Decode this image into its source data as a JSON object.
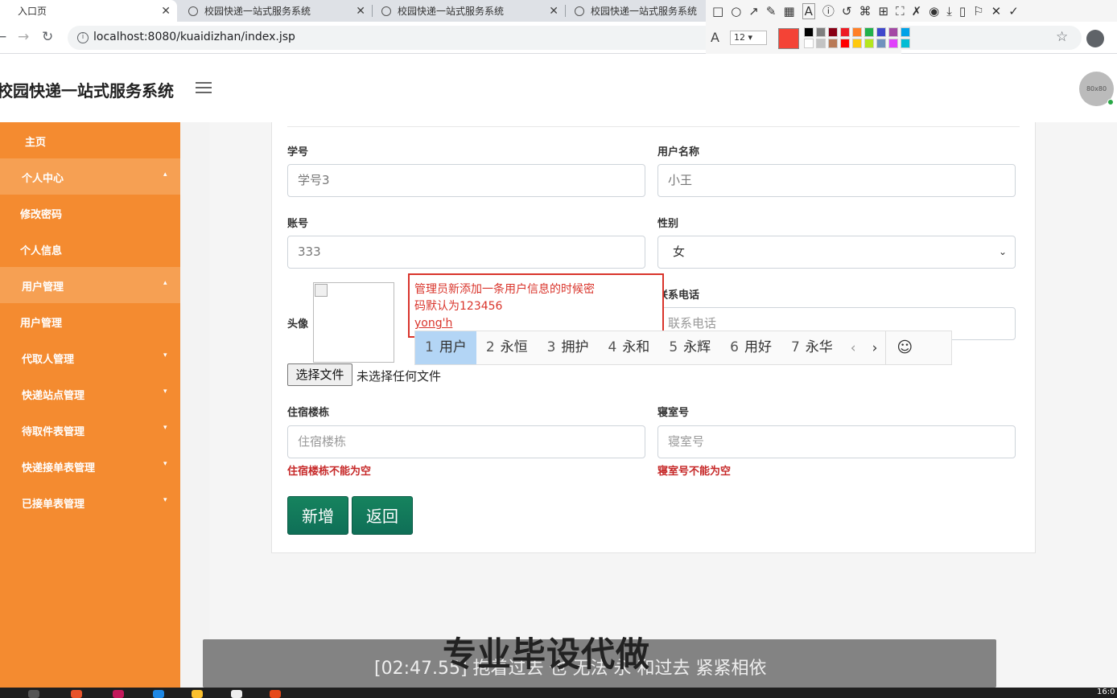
{
  "browser": {
    "tabs": [
      {
        "title": "入口页",
        "active": true
      },
      {
        "title": "校园快递一站式服务系统",
        "active": false
      },
      {
        "title": "校园快递一站式服务系统",
        "active": false
      },
      {
        "title": "校园快递一站式服务系统",
        "active": false
      }
    ],
    "url": "localhost:8080/kuaidizhan/index.jsp"
  },
  "annotation_toolbar": {
    "tools": [
      "rect-icon",
      "circle-icon",
      "arrow-icon",
      "pen-icon",
      "mosaic-icon",
      "text-icon",
      "number-icon",
      "undo-icon",
      "ocr-icon",
      "translate-icon",
      "pin-icon",
      "record-icon",
      "screen-record-icon",
      "download-icon",
      "save-icon",
      "bookmark-icon",
      "close-icon",
      "done-icon"
    ],
    "font_size": "12",
    "current_color": "#f44336",
    "swatches": [
      "#000000",
      "#7f7f7f",
      "#880015",
      "#ed1c24",
      "#ff7f27",
      "#22b14c",
      "#3f48cc",
      "#a349a4",
      "#00a2e8",
      "#ffffff",
      "#c3c3c3",
      "#b97a57",
      "#ff0000",
      "#ffc90e",
      "#b5e61d",
      "#7092be",
      "#e040fb",
      "#00bcd4"
    ]
  },
  "header": {
    "app_title": "校园快递一站式服务系统",
    "avatar_text": "80x80"
  },
  "sidebar": {
    "home": "主页",
    "personal_center": "个人中心",
    "change_password": "修改密码",
    "personal_info": "个人信息",
    "user_mgmt_group": "用户管理",
    "user_mgmt": "用户管理",
    "agent_mgmt": "代取人管理",
    "station_mgmt": "快递站点管理",
    "pickup_mgmt": "待取件表管理",
    "order_mgmt": "快递接单表管理",
    "accepted_mgmt": "已接单表管理"
  },
  "form": {
    "student_id": {
      "label": "学号",
      "value": "学号3"
    },
    "username": {
      "label": "用户名称",
      "value": "小王"
    },
    "account": {
      "label": "账号",
      "value": "333"
    },
    "gender": {
      "label": "性别",
      "value": "女"
    },
    "avatar": {
      "label": "头像",
      "file_button": "选择文件",
      "file_status": "未选择任何文件"
    },
    "phone": {
      "label": "联系电话",
      "placeholder": "联系电话"
    },
    "dorm_building": {
      "label": "住宿楼栋",
      "placeholder": "住宿楼栋",
      "error": "住宿楼栋不能为空"
    },
    "dorm_room": {
      "label": "寝室号",
      "placeholder": "寝室号",
      "error": "寝室号不能为空"
    },
    "add_button": "新增",
    "back_button": "返回"
  },
  "annotation_note": {
    "line1": "管理员新添加一条用户信息的时候密",
    "line2": "码默认为123456",
    "typing": "yong'h"
  },
  "ime": {
    "candidates": [
      {
        "n": "1",
        "text": "用户"
      },
      {
        "n": "2",
        "text": "永恒"
      },
      {
        "n": "3",
        "text": "拥护"
      },
      {
        "n": "4",
        "text": "永和"
      },
      {
        "n": "5",
        "text": "永辉"
      },
      {
        "n": "6",
        "text": "用好"
      },
      {
        "n": "7",
        "text": "永华"
      }
    ]
  },
  "overlay": {
    "subtitle": "[02:47.55] 抱着过去 也 无法 永 和过去 紧紧相依",
    "watermark": "专业毕设代做"
  },
  "taskbar": {
    "clock": "16:0"
  }
}
